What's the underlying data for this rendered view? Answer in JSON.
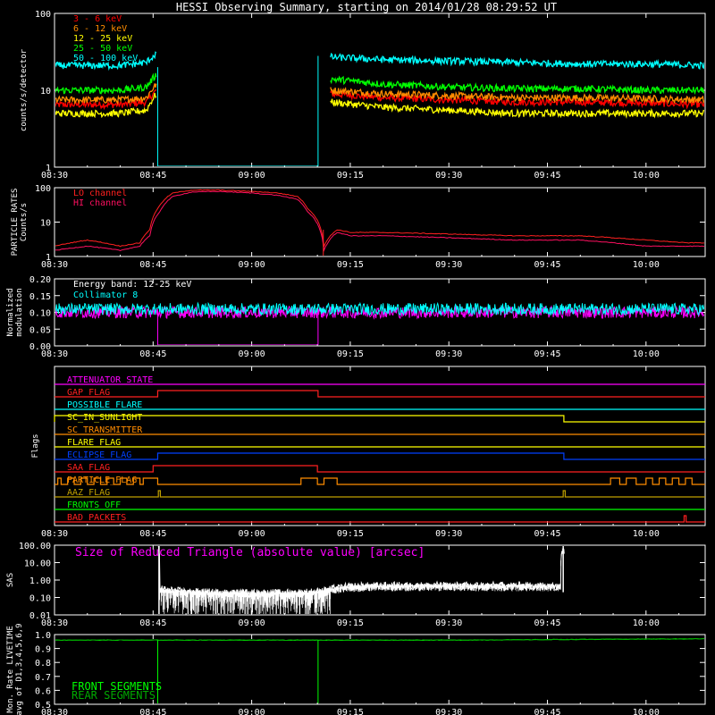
{
  "title": "HESSI Observing Summary, starting on 2014/01/28 08:29:52 UT",
  "colors": {
    "background": "#000000",
    "axis": "#ffffff",
    "lightcurve_3_6": "#ff0000",
    "lightcurve_6_12": "#ff8c00",
    "lightcurve_12_25": "#ffff00",
    "lightcurve_25_50": "#00ff00",
    "lightcurve_50_100": "#00ffff",
    "particle": "#ff2020",
    "particle_hi": "#ff1060",
    "modulation_energy": "#ff00ff",
    "modulation_collimator": "#00ffff",
    "sas": "#ffffff",
    "sas_label": "#ff00ff",
    "front_segments": "#00ff00",
    "rear_segments": "#00aa00"
  },
  "time_axis": {
    "start_min": 510,
    "end_min": 609,
    "tick_labels": [
      "08:30",
      "08:45",
      "09:00",
      "09:15",
      "09:30",
      "09:45",
      "10:00"
    ],
    "ticks_min": [
      510,
      525,
      540,
      555,
      570,
      585,
      600
    ]
  },
  "chart_data": [
    {
      "id": "lightcurves",
      "type": "line",
      "ylabel": "counts/s/detector",
      "yscale": "log",
      "ylim": [
        1,
        100
      ],
      "ytick_labels": [
        "1",
        "10",
        "100"
      ],
      "ticks": [
        1,
        10,
        100
      ],
      "gap": [
        525.7,
        537.0,
        545.5,
        550.0,
        561.2
      ],
      "x": [
        510,
        520,
        524,
        525.5,
        525.7,
        550.2,
        552,
        560,
        570,
        580,
        590,
        600,
        609
      ],
      "series": [
        {
          "name": "3 - 6 keV",
          "color": "#ff0000",
          "values": [
            6.5,
            6.5,
            7,
            10,
            null,
            null,
            9,
            8,
            7.5,
            7,
            7,
            6.8,
            6.5
          ]
        },
        {
          "name": "6 - 12 keV",
          "color": "#ff8c00",
          "values": [
            7.5,
            7.5,
            8,
            12,
            null,
            null,
            10,
            9,
            8.5,
            8,
            8,
            7.8,
            7.5
          ]
        },
        {
          "name": "12 - 25 keV",
          "color": "#ffff00",
          "values": [
            5,
            5,
            5.5,
            9,
            null,
            null,
            7,
            6,
            5.5,
            5,
            5,
            5,
            5
          ]
        },
        {
          "name": "25 - 50 keV",
          "color": "#00ff00",
          "values": [
            10,
            10,
            11,
            16,
            null,
            null,
            14,
            12,
            11,
            10.5,
            10.5,
            10,
            10
          ]
        },
        {
          "name": "50 - 100 keV",
          "color": "#00ffff",
          "values": [
            21,
            21,
            23,
            30,
            null,
            null,
            27,
            25,
            24,
            23,
            22,
            22,
            21
          ]
        }
      ]
    },
    {
      "id": "particle",
      "type": "line",
      "ylabel": "PARTICLE RATES Counts/s",
      "yscale": "log",
      "ylim": [
        1,
        100
      ],
      "ytick_labels": [
        "1",
        "10",
        "100"
      ],
      "ticks": [
        1,
        10,
        100
      ],
      "x": [
        510,
        515,
        520,
        523,
        524.5,
        526,
        528,
        531,
        535,
        540,
        544,
        547,
        548.5,
        551,
        553,
        555,
        560,
        570,
        580,
        590,
        600,
        606,
        609
      ],
      "series": [
        {
          "name": "LO channel",
          "color": "#ff2020",
          "values": [
            2,
            3,
            2,
            2.5,
            6,
            30,
            70,
            85,
            85,
            78,
            70,
            55,
            25,
            2,
            6,
            5,
            5,
            4.5,
            4,
            4,
            3,
            2.5,
            2.5
          ]
        },
        {
          "name": "HI channel",
          "color": "#ff1060",
          "values": [
            1.5,
            2,
            1.5,
            2,
            4,
            20,
            55,
            75,
            78,
            70,
            60,
            45,
            20,
            1.5,
            5,
            4,
            4,
            3.5,
            3,
            3,
            2,
            2,
            2
          ]
        }
      ]
    },
    {
      "id": "modulation",
      "type": "line",
      "ylabel": "Normalized modulation",
      "ylim": [
        0,
        0.2
      ],
      "ytick_labels": [
        "0.00",
        "0.05",
        "0.10",
        "0.15",
        "0.20"
      ],
      "ticks": [
        0,
        0.05,
        0.1,
        0.15,
        0.2
      ],
      "gap": [
        525.7,
        550.0
      ],
      "x": [
        510,
        515,
        520,
        525.6,
        550.3,
        560,
        570,
        580,
        590,
        600,
        609
      ],
      "series": [
        {
          "name": "Energy band: 12-25 keV",
          "color": "#ff00ff",
          "values": [
            0.1,
            0.1,
            0.1,
            0.1,
            0.1,
            0.1,
            0.1,
            0.1,
            0.1,
            0.1,
            0.1
          ]
        },
        {
          "name": "Collimator 8",
          "color": "#00ffff",
          "values": [
            0.11,
            0.11,
            0.11,
            0.11,
            0.11,
            0.11,
            0.11,
            0.11,
            0.11,
            0.11,
            0.11
          ]
        }
      ]
    },
    {
      "id": "flags",
      "type": "line",
      "ylabel": "Flags",
      "flags": [
        {
          "name": "ATTENUATOR_STATE",
          "color": "#ff00ff",
          "on": []
        },
        {
          "name": "GAP_FLAG",
          "color": "#ff2020",
          "on": [
            [
              525.7,
              550.1
            ]
          ]
        },
        {
          "name": "POSSIBLE_FLARE",
          "color": "#00ffff",
          "on": []
        },
        {
          "name": "SC_IN_SUNLIGHT",
          "color": "#ffff00",
          "on": [
            [
              510,
              587.5
            ]
          ]
        },
        {
          "name": "SC_TRANSMITTER",
          "color": "#ff8c00",
          "on": []
        },
        {
          "name": "FLARE_FLAG",
          "color": "#ffff00",
          "on": []
        },
        {
          "name": "ECLIPSE_FLAG",
          "color": "#0040ff",
          "on": [
            [
              525.7,
              587.5
            ]
          ]
        },
        {
          "name": "SAA_FLAG",
          "color": "#ff2020",
          "on": [
            [
              525,
              550
            ]
          ]
        },
        {
          "name": "PARTICLE_FLAG",
          "color": "#ff8c00",
          "on": [
            [
              510.5,
              511
            ],
            [
              512,
              513
            ],
            [
              514,
              515
            ],
            [
              516,
              517
            ],
            [
              518,
              519
            ],
            [
              520,
              521
            ],
            [
              522,
              523
            ],
            [
              523.5,
              525.7
            ],
            [
              547.5,
              550
            ],
            [
              551,
              553
            ],
            [
              594.6,
              596
            ],
            [
              597,
              598.5
            ],
            [
              600,
              601
            ],
            [
              602,
              603
            ],
            [
              604,
              605
            ],
            [
              606,
              607
            ]
          ]
        },
        {
          "name": "AAZ_FLAG",
          "color": "#c0a000",
          "on": [
            [
              525.8,
              526.1
            ],
            [
              587.4,
              587.7
            ]
          ]
        },
        {
          "name": "FRONTS_OFF",
          "color": "#00ff00",
          "on": []
        },
        {
          "name": "BAD_PACKETS",
          "color": "#ff2020",
          "on": [
            [
              605.8,
              606.1
            ]
          ]
        }
      ]
    },
    {
      "id": "sas",
      "type": "line",
      "ylabel": "SAS",
      "label": "Size of Reduced Triangle (absolute value) [arcsec]",
      "yscale": "log",
      "ylim": [
        0.01,
        100
      ],
      "ytick_labels": [
        "0.01",
        "0.10",
        "1.00",
        "10.00",
        "100.00"
      ],
      "ticks": [
        0.01,
        0.1,
        1,
        10,
        100
      ],
      "x": [
        525.8,
        526.0,
        527,
        530,
        535,
        540,
        545,
        550,
        555,
        560,
        570,
        580,
        587,
        587.4,
        587.6
      ],
      "series": [
        {
          "name": "Size of Reduced Triangle (absolute value) [arcsec]",
          "color": "#ffffff",
          "values": [
            100,
            0.3,
            0.25,
            0.2,
            0.18,
            0.17,
            0.17,
            0.2,
            0.4,
            0.45,
            0.45,
            0.45,
            0.45,
            100,
            0.45
          ]
        }
      ]
    },
    {
      "id": "livetime",
      "type": "line",
      "ylabel": "Mon. Rate LIVETIME avg of D1,3,4,5,6,9",
      "ylim": [
        0.5,
        1.0
      ],
      "ytick_labels": [
        "0.5",
        "0.6",
        "0.7",
        "0.8",
        "0.9",
        "1.0"
      ],
      "ticks": [
        0.5,
        0.6,
        0.7,
        0.8,
        0.9,
        1.0
      ],
      "gap": [
        525.7,
        550.0
      ],
      "x": [
        510,
        525.6,
        550.3,
        570,
        590,
        609
      ],
      "series": [
        {
          "name": "FRONT SEGMENTS",
          "color": "#00ff00",
          "values": [
            0.96,
            0.96,
            0.96,
            0.96,
            0.965,
            0.97
          ]
        },
        {
          "name": "REAR SEGMENTS",
          "color": "#00aa00",
          "values": [
            0.96,
            0.96,
            0.96,
            0.96,
            0.965,
            0.97
          ]
        }
      ]
    }
  ]
}
